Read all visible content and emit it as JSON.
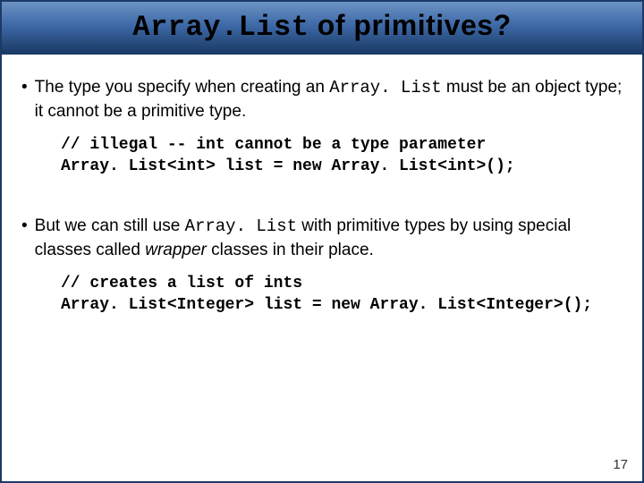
{
  "title": {
    "mono": "Array.List",
    "rest": " of primitives?"
  },
  "bullets": [
    {
      "pre": "The type you specify when creating an ",
      "mono": "Array. List",
      "post": " must be an object type; it cannot be a primitive type."
    },
    {
      "pre": "But we can still use ",
      "mono": "Array. List",
      "post_a": " with primitive types by using special classes called ",
      "italic": "wrapper",
      "post_b": " classes in their place."
    }
  ],
  "code1": "// illegal -- int cannot be a type parameter\nArray. List<int> list = new Array. List<int>();",
  "code2": "// creates a list of ints\nArray. List<Integer> list = new Array. List<Integer>();",
  "page": "17"
}
